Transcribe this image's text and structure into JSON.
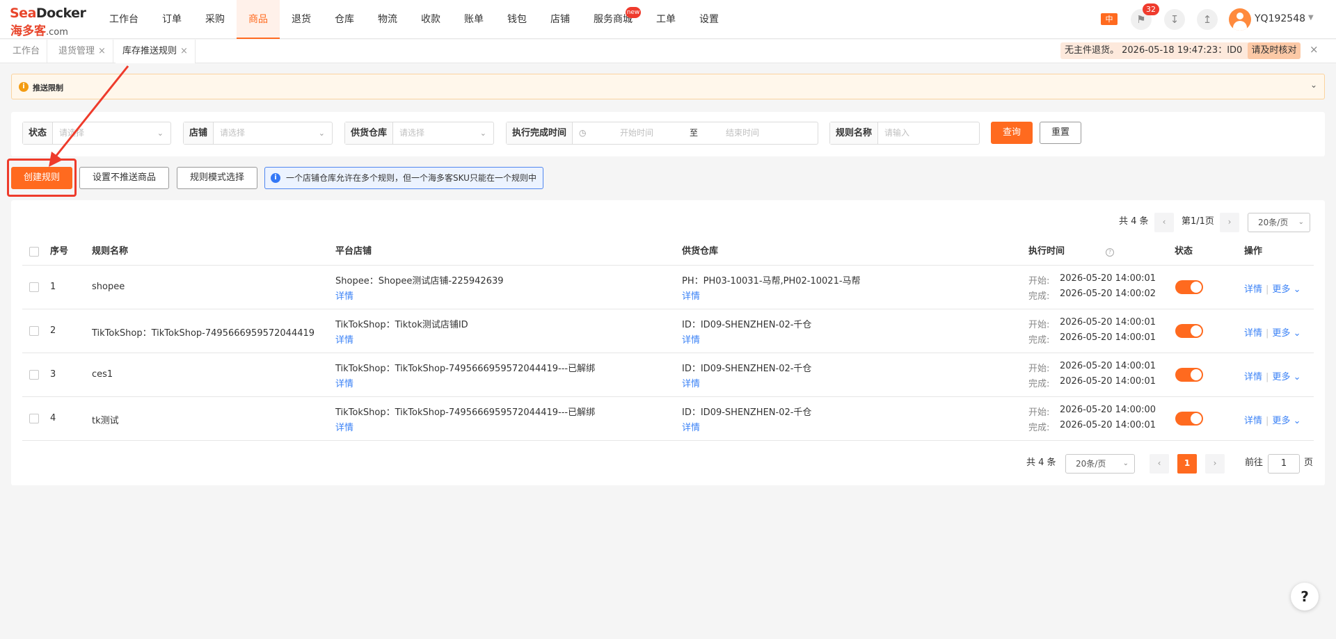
{
  "logo": {
    "brand_a": "Sea",
    "brand_b": "Docker",
    "cn": "海多客",
    "dotcom": ".com"
  },
  "nav": [
    "工作台",
    "订单",
    "采购",
    "商品",
    "退货",
    "仓库",
    "物流",
    "收款",
    "账单",
    "钱包",
    "店铺",
    "服务商城",
    "工单",
    "设置"
  ],
  "nav_active_index": 3,
  "nav_badge": "new",
  "header": {
    "lang": "中",
    "message_count": "32",
    "username": "YQ192548"
  },
  "tabs": [
    {
      "label": "工作台",
      "closable": false
    },
    {
      "label": "退货管理",
      "closable": true
    },
    {
      "label": "库存推送规则",
      "closable": true,
      "active": true
    }
  ],
  "notice": {
    "text": "无主件退货。 2026-05-18 19:47:23：ID0",
    "button": "请及时核对"
  },
  "alert": {
    "title": "推送限制"
  },
  "filters": {
    "status": {
      "label": "状态",
      "placeholder": "请选择"
    },
    "store": {
      "label": "店铺",
      "placeholder": "请选择"
    },
    "warehouse": {
      "label": "供货仓库",
      "placeholder": "请选择"
    },
    "time": {
      "label": "执行完成时间",
      "start": "开始时间",
      "to": "至",
      "end": "结束时间"
    },
    "rule_name": {
      "label": "规则名称",
      "placeholder": "请输入"
    },
    "query": "查询",
    "reset": "重置"
  },
  "actions": {
    "create": "创建规则",
    "no_push": "设置不推送商品",
    "mode": "规则模式选择",
    "tip": "一个店铺仓库允许在多个规则，但一个海多客SKU只能在一个规则中"
  },
  "pager_top": {
    "total": "共 4 条",
    "page": "第1/1页",
    "size": "20条/页"
  },
  "table": {
    "headers": [
      "序号",
      "规则名称",
      "平台店铺",
      "供货仓库",
      "执行时间",
      "状态",
      "操作"
    ],
    "detail_label": "详情",
    "more_label": "更多",
    "start_label": "开始:",
    "end_label": "完成:",
    "rows": [
      {
        "no": "1",
        "name": "shopee",
        "store": "Shopee：Shopee测试店铺-225942639",
        "warehouse": "PH：PH03-10031-马帮,PH02-10021-马帮",
        "start": "2026-05-20 14:00:01",
        "end": "2026-05-20 14:00:02",
        "enabled": true
      },
      {
        "no": "2",
        "name": "TikTokShop：TikTokShop-7495666959572044419",
        "store": "TikTokShop：Tiktok测试店铺ID",
        "warehouse": "ID：ID09-SHENZHEN-02-千仓",
        "start": "2026-05-20 14:00:01",
        "end": "2026-05-20 14:00:01",
        "enabled": true
      },
      {
        "no": "3",
        "name": "ces1",
        "store": "TikTokShop：TikTokShop-7495666959572044419---已解绑",
        "warehouse": "ID：ID09-SHENZHEN-02-千仓",
        "start": "2026-05-20 14:00:01",
        "end": "2026-05-20 14:00:01",
        "enabled": true
      },
      {
        "no": "4",
        "name": "tk测试",
        "store": "TikTokShop：TikTokShop-7495666959572044419---已解绑",
        "warehouse": "ID：ID09-SHENZHEN-02-千仓",
        "start": "2026-05-20 14:00:00",
        "end": "2026-05-20 14:00:01",
        "enabled": true
      }
    ]
  },
  "pager_bottom": {
    "total": "共 4 条",
    "size": "20条/页",
    "current": "1",
    "goto": "前往",
    "goto_value": "1",
    "page_unit": "页"
  },
  "help": "?",
  "colors": {
    "accent": "#ff6a1f",
    "link": "#3b82f6",
    "annotation": "#ee3b2b"
  }
}
